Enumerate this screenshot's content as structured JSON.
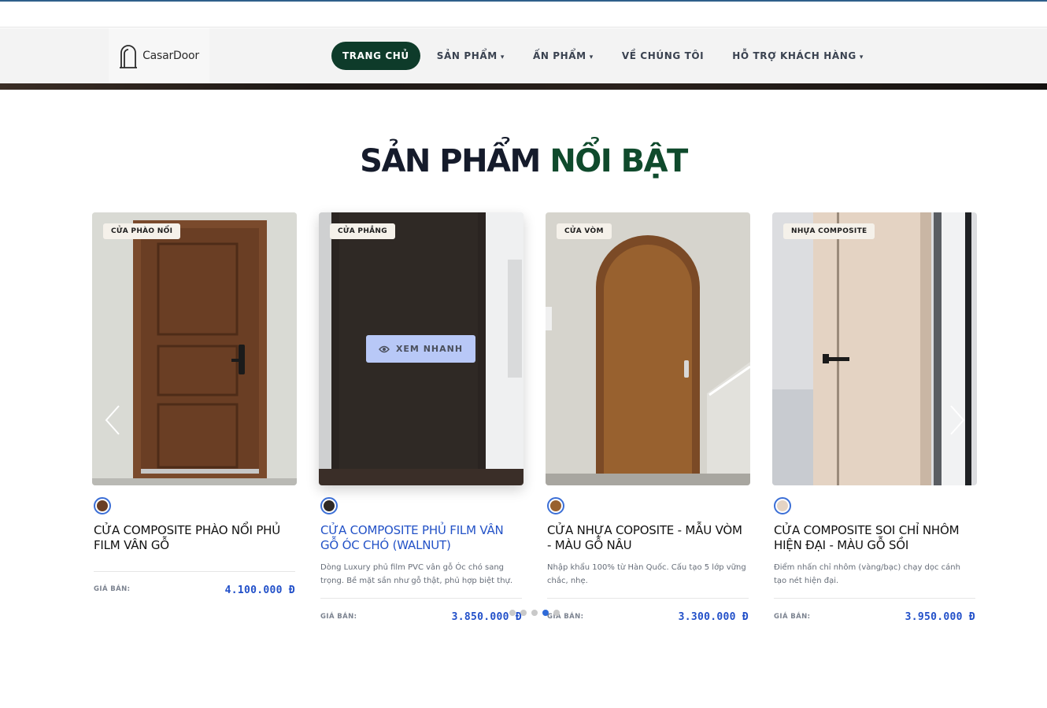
{
  "header": {
    "logo_text": "CasarDoor",
    "nav": [
      {
        "label": "TRANG CHỦ",
        "active": true,
        "has_dropdown": false
      },
      {
        "label": "SẢN PHẨM",
        "active": false,
        "has_dropdown": true
      },
      {
        "label": "ẤN PHẨM",
        "active": false,
        "has_dropdown": true
      },
      {
        "label": "VỀ CHÚNG TÔI",
        "active": false,
        "has_dropdown": false
      },
      {
        "label": "HỖ TRỢ KHÁCH HÀNG",
        "active": false,
        "has_dropdown": true
      }
    ],
    "caret": "▾"
  },
  "section": {
    "title_main": "SẢN PHẨM",
    "title_accent": "NỔI BẬT"
  },
  "products": [
    {
      "badge": "CỬA PHÀO NỔI",
      "name": "CỬA COMPOSITE PHÀO NỔI PHỦ FILM VÂN GỖ",
      "description": "",
      "price_label": "GIÁ BÁN:",
      "price": "4.100.000 Đ"
    },
    {
      "badge": "CỬA PHẲNG",
      "name": "CỬA COMPOSITE PHỦ FILM VÂN GỖ ÓC CHÓ (WALNUT)",
      "description": "Dòng Luxury phủ film PVC vân gỗ Óc chó sang trọng. Bề mặt sần như gỗ thật, phủ hợp biệt thự.",
      "price_label": "GIÁ BÁN:",
      "price": "3.850.000 Đ",
      "quick_view": "XEM NHANH"
    },
    {
      "badge": "CỬA VÒM",
      "name": "CỬA NHỰA COPOSITE - MẪU VÒM - MÀU GỖ NÂU",
      "description": "Nhập khẩu 100% từ Hàn Quốc. Cấu tạo 5 lớp vững chắc, nhẹ.",
      "price_label": "GIÁ BÁN:",
      "price": "3.300.000 Đ"
    },
    {
      "badge": "NHỰA COMPOSITE",
      "name": "CỬA COMPOSITE SOI CHỈ NHÔM HIỆN ĐẠI - MÀU GỖ SỒI",
      "description": "Điểm nhấn chỉ nhôm (vàng/bạc) chạy dọc cánh tạo nét hiện đại.",
      "price_label": "GIÁ BÁN:",
      "price": "3.950.000 Đ"
    }
  ],
  "carousel": {
    "dot_count": 5,
    "active_dot": 3
  },
  "colors": {
    "brand_green": "#0e3b2a",
    "accent_blue": "#2250c9",
    "title_dark": "#151b2b"
  }
}
